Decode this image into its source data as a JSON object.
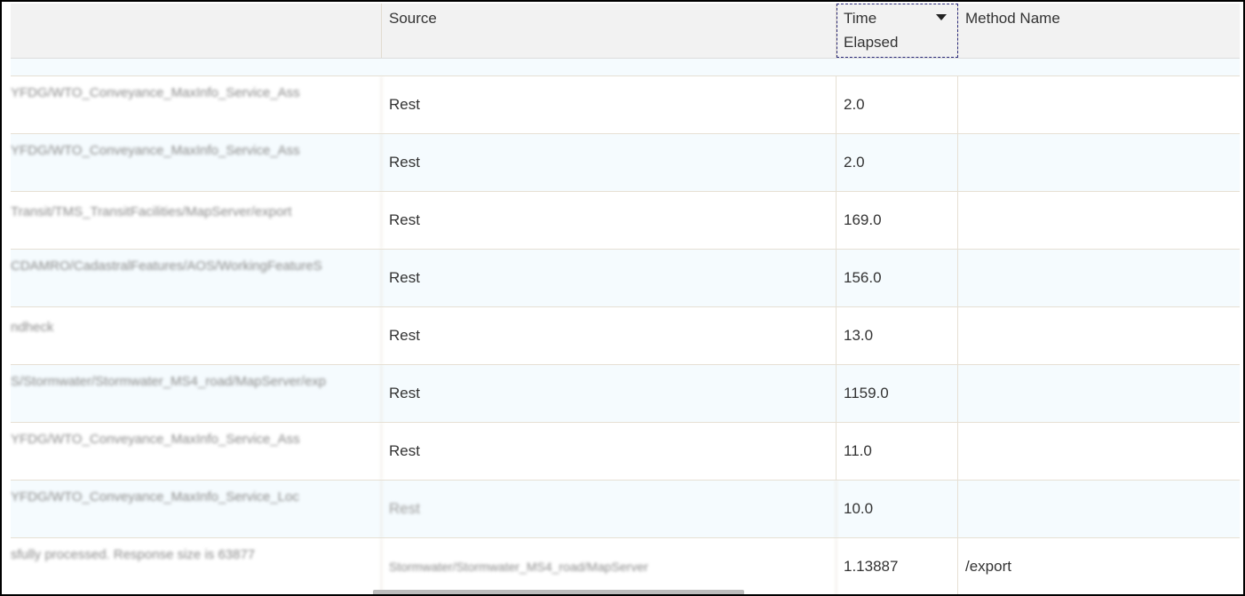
{
  "columns": {
    "message": "",
    "source": "Source",
    "time_elapsed": "Time Elapsed",
    "method_name": "Method Name"
  },
  "rows": [
    {
      "message": "YFDG/WTO_Conveyance_MaxInfo_Service_Ass",
      "source": "Rest",
      "time": "2.0",
      "method": ""
    },
    {
      "message": "YFDG/WTO_Conveyance_MaxInfo_Service_Ass",
      "source": "Rest",
      "time": "2.0",
      "method": ""
    },
    {
      "message": "Transit/TMS_TransitFacilities/MapServer/export",
      "source": "Rest",
      "time": "169.0",
      "method": ""
    },
    {
      "message": "CDAMRO/CadastralFeatures/AOS/WorkingFeatureS",
      "source": "Rest",
      "time": "156.0",
      "method": ""
    },
    {
      "message": "ndheck",
      "source": "Rest",
      "time": "13.0",
      "method": ""
    },
    {
      "message": "S/Stormwater/Stormwater_MS4_road/MapServer/exp",
      "source": "Rest",
      "time": "1159.0",
      "method": ""
    },
    {
      "message": "YFDG/WTO_Conveyance_MaxInfo_Service_Ass",
      "source": "Rest",
      "time": "11.0",
      "method": ""
    },
    {
      "message": "YFDG/WTO_Conveyance_MaxInfo_Service_Loc",
      "source": "Rest",
      "time": "10.0",
      "method": ""
    },
    {
      "message": "sfully processed. Response size is 63877",
      "source": "Stormwater/Stormwater_MS4_road/MapServer",
      "time": "1.13887",
      "method": "/export"
    }
  ],
  "colors": {
    "header_bg": "#f2f2f2",
    "alt_row_bg": "#f5fbfe",
    "grid_line": "#e6e0d4"
  }
}
